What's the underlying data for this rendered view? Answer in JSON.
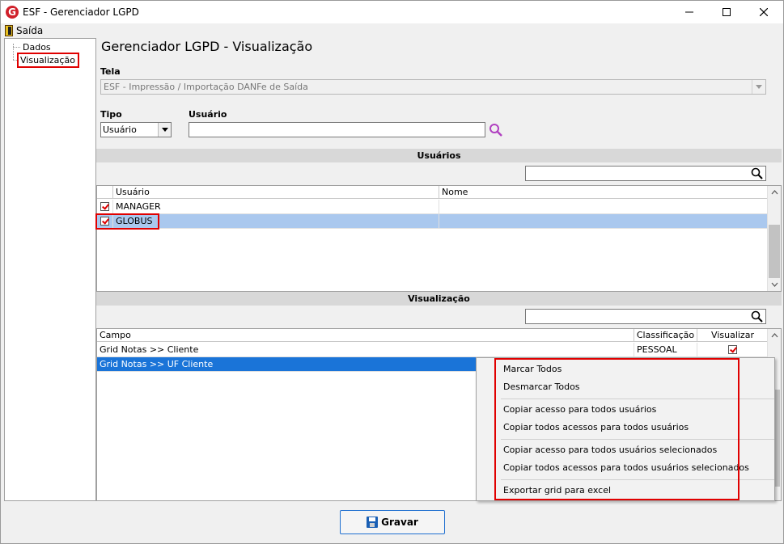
{
  "window": {
    "title": "ESF - Gerenciador LGPD",
    "icon_letter": "G"
  },
  "menu": {
    "saida": "Saída"
  },
  "tree": {
    "items": [
      {
        "label": "Dados"
      },
      {
        "label": "Visualização"
      }
    ]
  },
  "main": {
    "title": "Gerenciador LGPD - Visualização",
    "tela_label": "Tela",
    "tela_value": "ESF - Impressão / Importação DANFe de Saída",
    "tipo_label": "Tipo",
    "tipo_value": "Usuário",
    "usuario_label": "Usuário",
    "usuario_value": ""
  },
  "usuarios_section": {
    "header": "Usuários",
    "filter_value": "",
    "columns": [
      "Usuário",
      "Nome"
    ],
    "rows": [
      {
        "checked": true,
        "usuario": "MANAGER",
        "nome": ""
      },
      {
        "checked": true,
        "usuario": "GLOBUS",
        "nome": ""
      }
    ]
  },
  "visualizacao_section": {
    "header": "Visualização",
    "filter_value": "",
    "columns": [
      "Campo",
      "Classificação",
      "Visualizar"
    ],
    "rows": [
      {
        "campo": "Grid Notas >> Cliente",
        "classificacao": "PESSOAL",
        "visualizar": true
      },
      {
        "campo": "Grid Notas >> UF Cliente",
        "classificacao": "",
        "visualizar": false
      }
    ]
  },
  "context_menu": {
    "items": [
      "Marcar Todos",
      "Desmarcar Todos",
      "Copiar acesso para todos usuários",
      "Copiar todos acessos para todos usuários",
      "Copiar acesso para todos usuários selecionados",
      "Copiar todos acessos para todos usuários selecionados",
      "Exportar grid para excel"
    ]
  },
  "buttons": {
    "gravar": "Gravar"
  },
  "colors": {
    "highlight_red": "#e00000",
    "selection_blue": "#1a74d8",
    "row_selected": "#aac8ee"
  }
}
